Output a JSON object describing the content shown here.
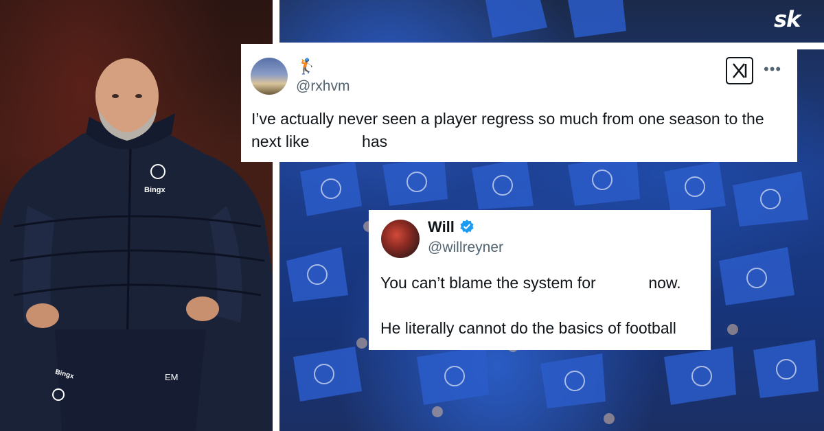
{
  "branding": {
    "logo_text": "sk"
  },
  "tweet_1": {
    "name_emoji": "🏌",
    "handle": "@rxhvm",
    "text": "I’ve actually never seen a player regress so much from one season to the\nnext like            has",
    "icons": [
      "x-logo-icon",
      "more-options-icon"
    ]
  },
  "tweet_2": {
    "display_name": "Will",
    "handle": "@willreyner",
    "verified": true,
    "text": "You can’t blame the system for            now.\n\nHe literally cannot do the basics of football"
  },
  "left_photo": {
    "jacket_sponsor": "Bingx",
    "shorts_sponsor": "Bingx",
    "initials": "EM"
  },
  "colors": {
    "brand_blue": "#1d4fb0",
    "text": "#0f1419",
    "muted": "#536471",
    "verified": "#1d9bf0"
  }
}
